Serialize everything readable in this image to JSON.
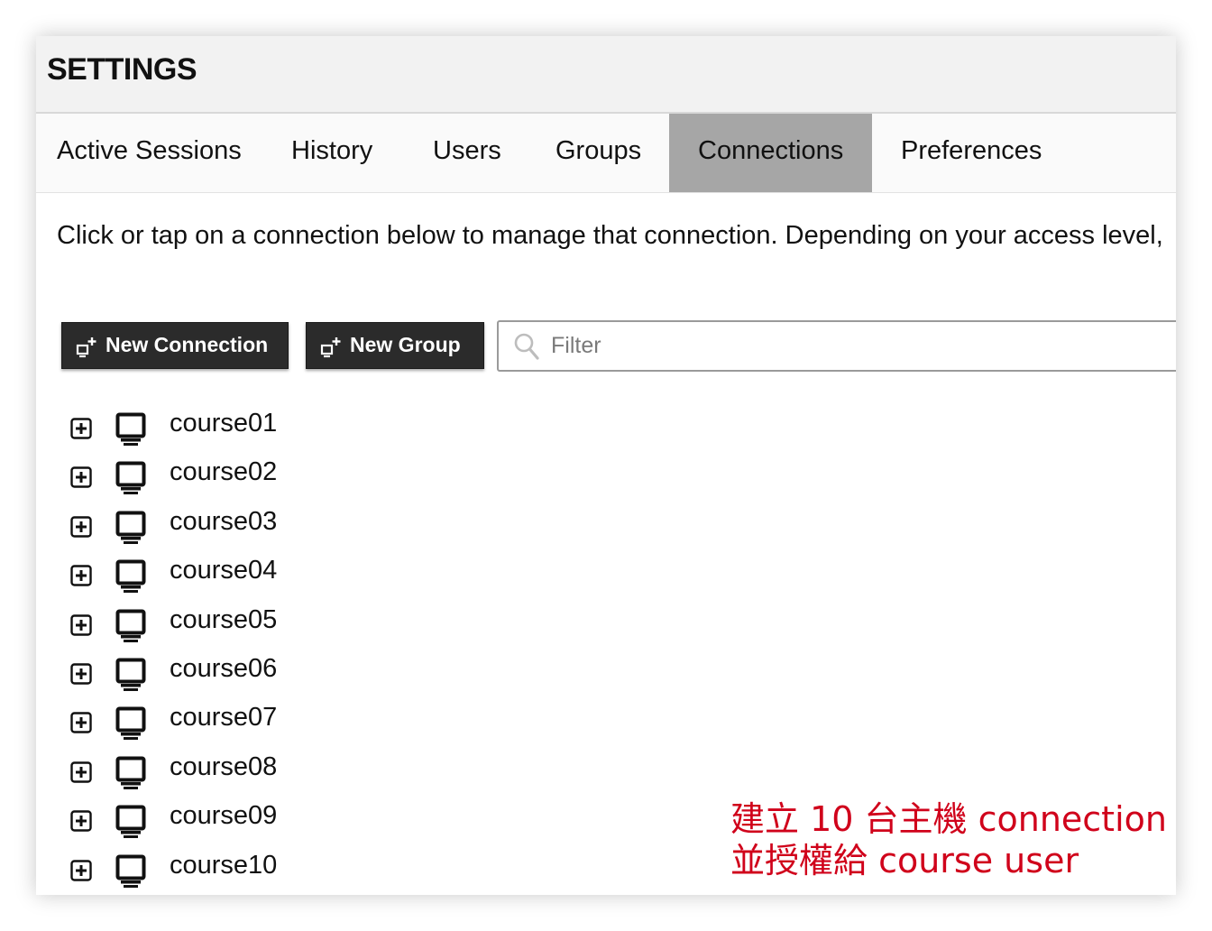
{
  "header": {
    "title": "SETTINGS"
  },
  "tabs": [
    {
      "label": "Active Sessions",
      "active": false
    },
    {
      "label": "History",
      "active": false
    },
    {
      "label": "Users",
      "active": false
    },
    {
      "label": "Groups",
      "active": false
    },
    {
      "label": "Connections",
      "active": true
    },
    {
      "label": "Preferences",
      "active": false
    }
  ],
  "main": {
    "instructions": "Click or tap on a connection below to manage that connection. Depending on your access level,",
    "new_connection_label": "New Connection",
    "new_group_label": "New Group",
    "filter": {
      "placeholder": "Filter",
      "value": ""
    },
    "connections": [
      {
        "name": "course01",
        "icon": "monitor-icon"
      },
      {
        "name": "course02",
        "icon": "monitor-icon"
      },
      {
        "name": "course03",
        "icon": "monitor-icon"
      },
      {
        "name": "course04",
        "icon": "monitor-icon"
      },
      {
        "name": "course05",
        "icon": "monitor-icon"
      },
      {
        "name": "course06",
        "icon": "monitor-icon"
      },
      {
        "name": "course07",
        "icon": "monitor-icon"
      },
      {
        "name": "course08",
        "icon": "monitor-icon"
      },
      {
        "name": "course09",
        "icon": "monitor-icon"
      },
      {
        "name": "course10",
        "icon": "monitor-icon"
      }
    ]
  },
  "annotation": {
    "line1": "建立 10 台主機 connection",
    "line2": "並授權給 course user"
  },
  "colors": {
    "active_tab": "#a6a6a6",
    "button_bg": "#2b2b2b",
    "annotation": "#d0021b"
  }
}
